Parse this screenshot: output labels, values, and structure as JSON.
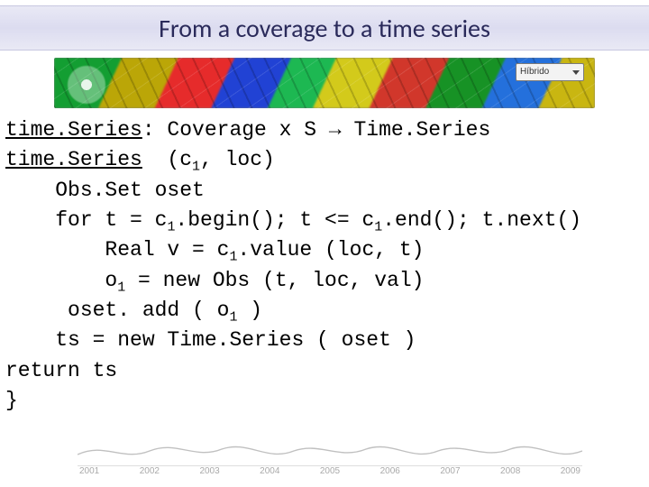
{
  "title": "From a coverage to a time series",
  "hibrido_label": "Híbrido",
  "code": {
    "l1a": "time.Series",
    "l1b": ": Coverage x S → Time.Series",
    "l2a": "time.Series",
    "l2b": "  (c",
    "l2c": ", loc)",
    "l3": "    Obs.Set oset",
    "l4a": "    for t = c",
    "l4b": ".begin(); t <= c",
    "l4c": ".end(); t.next()",
    "l5a": "        Real v = c",
    "l5b": ".value (loc, t)",
    "l6a": "        o",
    "l6b": " = new Obs (t, loc, val)",
    "l7a": "     oset. add ( o",
    "l7b": " )",
    "l8": "    ts = new Time.Series ( oset )",
    "l9": "return ts",
    "l10": "}",
    "sub1": "1"
  },
  "years": [
    "2001",
    "2002",
    "2003",
    "2004",
    "2005",
    "2006",
    "2007",
    "2008",
    "2009"
  ]
}
